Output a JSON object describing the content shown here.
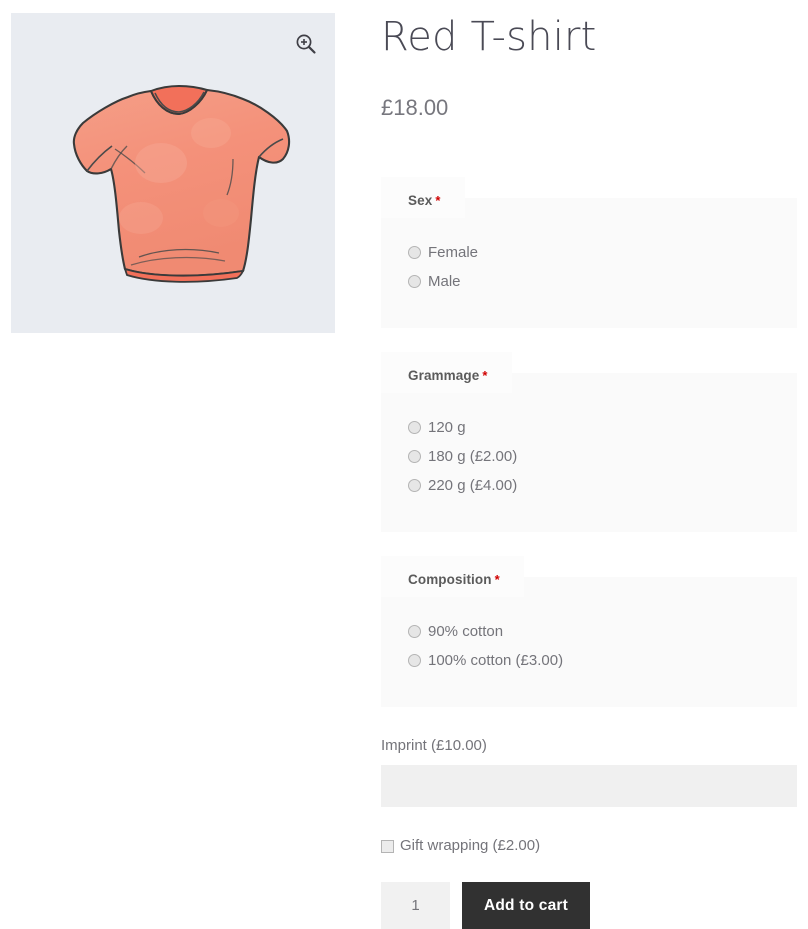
{
  "product": {
    "title": "Red T-shirt",
    "price": "£18.00",
    "image_alt": "red-tshirt-illustration",
    "zoom_icon": "magnifier-plus-icon",
    "gallery_bg": "#e9ecf1",
    "shirt_color": "#f4927c",
    "shirt_shadow_color": "#f2705a"
  },
  "form": {
    "required_star": "*",
    "groups": [
      {
        "legend": "Sex",
        "required": true,
        "options": [
          {
            "label": "Female",
            "selected": false
          },
          {
            "label": "Male",
            "selected": false
          }
        ]
      },
      {
        "legend": "Grammage",
        "required": true,
        "options": [
          {
            "label": "120 g",
            "selected": false
          },
          {
            "label": "180 g (£2.00)",
            "selected": false
          },
          {
            "label": "220 g (£4.00)",
            "selected": false
          }
        ]
      },
      {
        "legend": "Composition",
        "required": true,
        "options": [
          {
            "label": "90% cotton",
            "selected": false
          },
          {
            "label": "100% cotton (£3.00)",
            "selected": false
          }
        ]
      }
    ],
    "imprint": {
      "label": "Imprint (£10.00)",
      "value": "",
      "placeholder": ""
    },
    "gift_wrapping": {
      "label": "Gift wrapping (£2.00)",
      "checked": false
    },
    "quantity": {
      "value": "1"
    },
    "add_to_cart_label": "Add to cart"
  },
  "colors": {
    "accent_required": "#d00000",
    "button_bg": "#313131",
    "fieldset_bg": "#fafafa",
    "legend_bg": "#fcfcfc",
    "input_bg": "#f0f0f0",
    "text": "#74747a",
    "title": "#4a4a55"
  }
}
